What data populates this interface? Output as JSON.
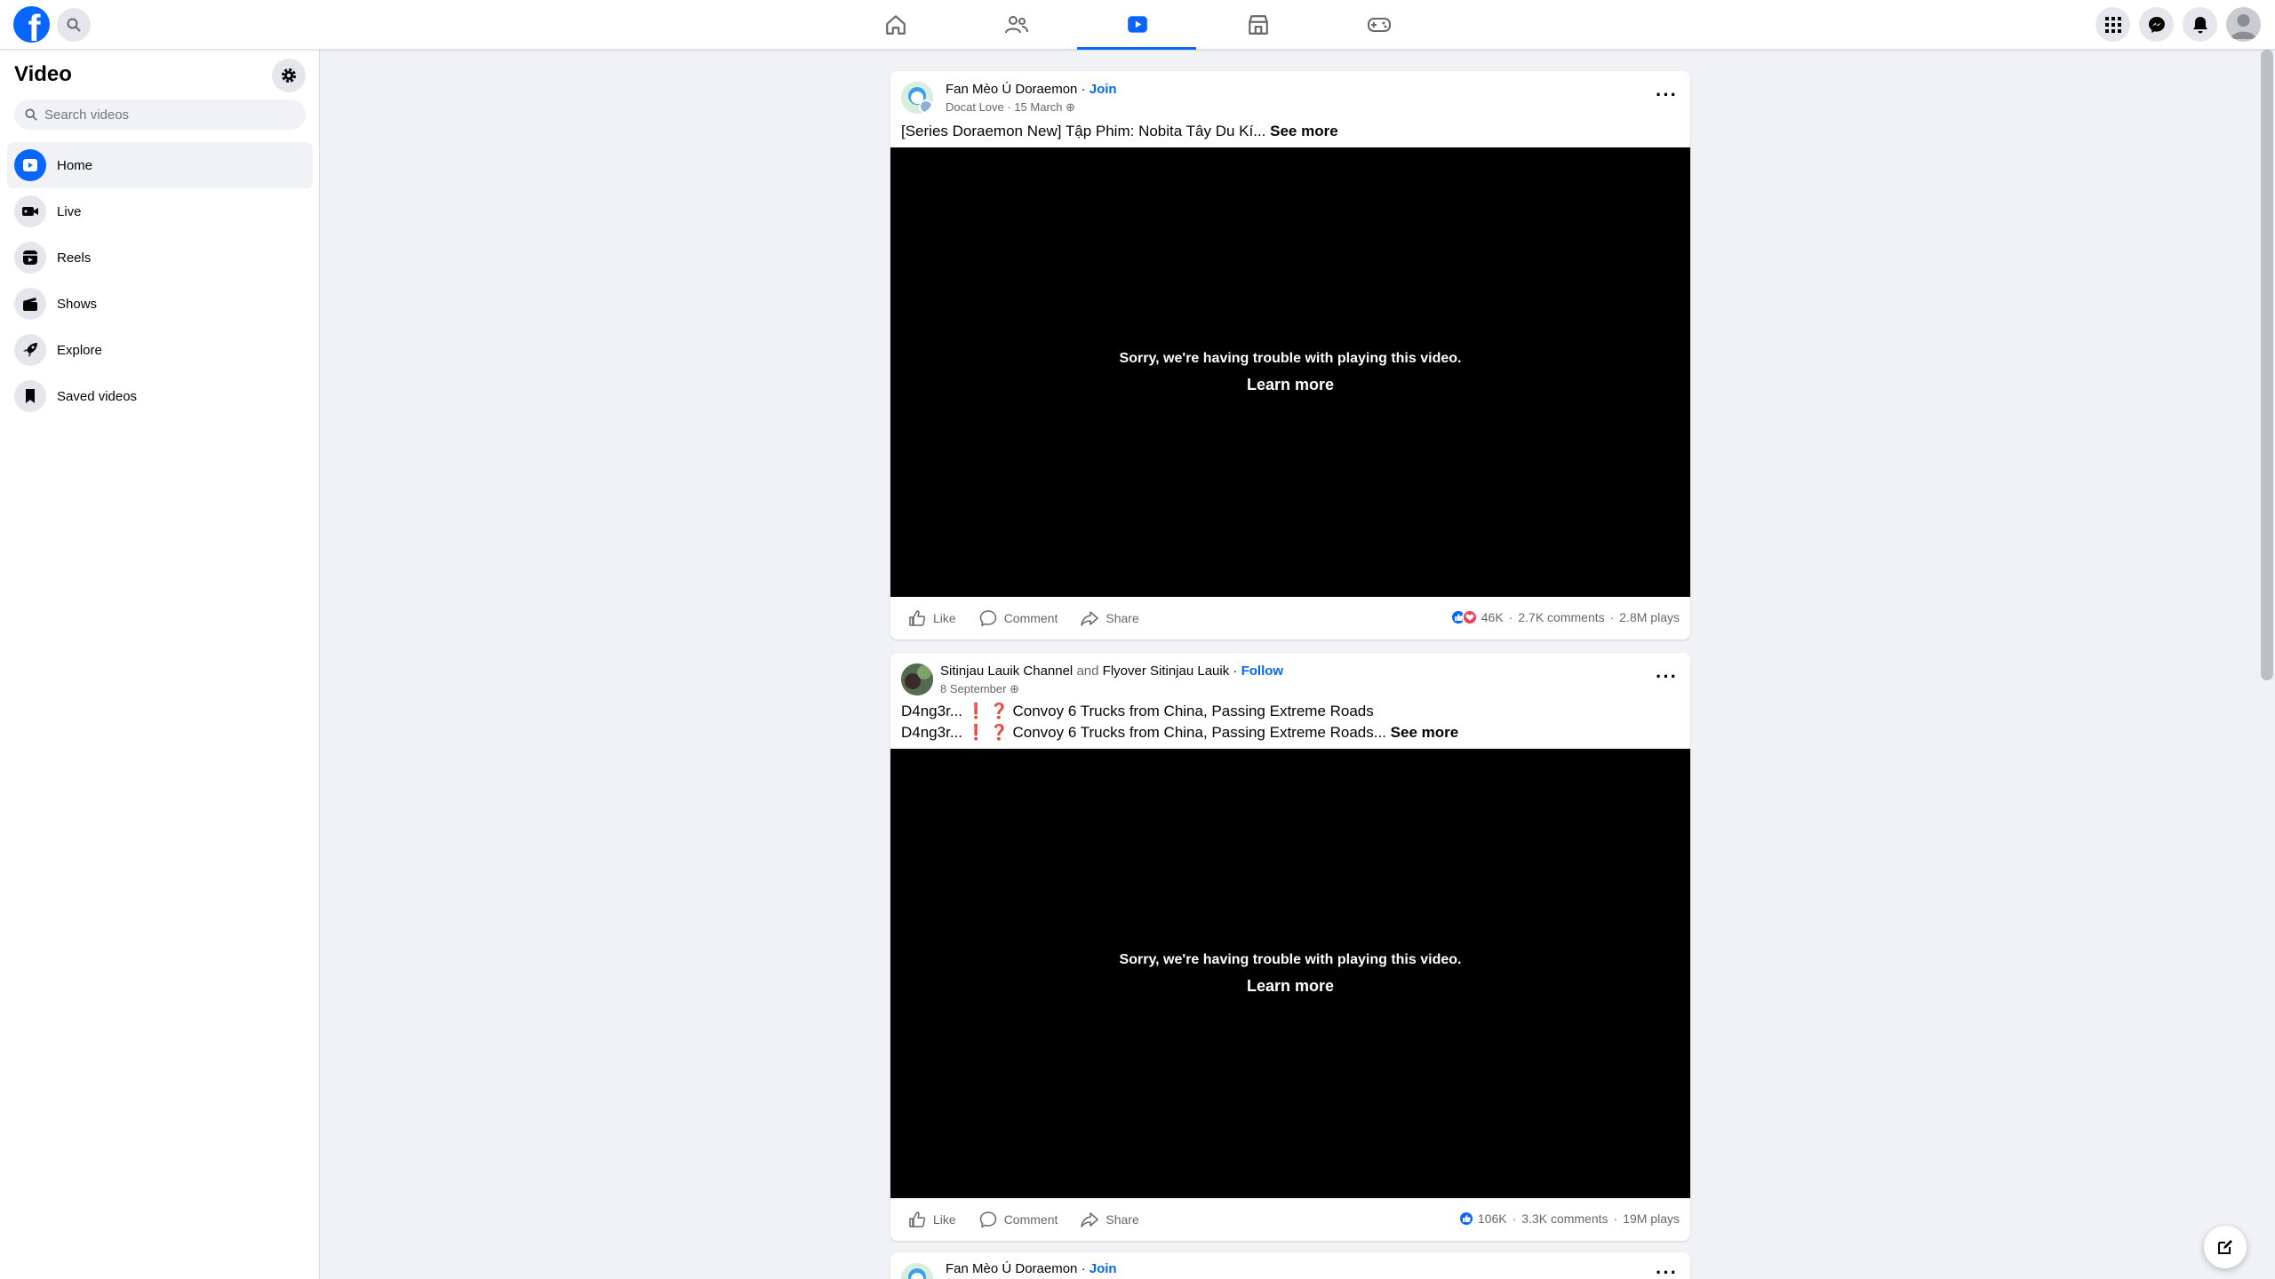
{
  "header": {
    "nav_tabs": [
      {
        "name": "home",
        "active": false
      },
      {
        "name": "friends",
        "active": false
      },
      {
        "name": "video",
        "active": true
      },
      {
        "name": "marketplace",
        "active": false
      },
      {
        "name": "gaming",
        "active": false
      }
    ],
    "accent_color": "#0866ff"
  },
  "sidebar": {
    "title": "Video",
    "search_placeholder": "Search videos",
    "items": [
      {
        "label": "Home",
        "icon": "play-icon",
        "active": true
      },
      {
        "label": "Live",
        "icon": "live-camera-icon",
        "active": false
      },
      {
        "label": "Reels",
        "icon": "reels-icon",
        "active": false
      },
      {
        "label": "Shows",
        "icon": "clapper-icon",
        "active": false
      },
      {
        "label": "Explore",
        "icon": "rocket-icon",
        "active": false
      },
      {
        "label": "Saved videos",
        "icon": "bookmark-icon",
        "active": false
      }
    ]
  },
  "posts": [
    {
      "author": "Fan Mèo Ú Doraemon",
      "action": "Join",
      "sub_author": "Docat Love",
      "date": "15 March",
      "caption": "[Series Doraemon New] Tập Phim: Nobita Tây Du Kí...",
      "see_more": "See more",
      "video_error": "Sorry, we're having trouble with playing this video.",
      "learn_more": "Learn more",
      "like": "Like",
      "comment": "Comment",
      "share": "Share",
      "reactions": "46K",
      "comments": "2.7K comments",
      "plays": "2.8M plays"
    },
    {
      "author": "Sitinjau Lauik Channel",
      "and": "and",
      "co_author": "Flyover Sitinjau Lauik",
      "action": "Follow",
      "date": "8 September",
      "title": "D4ng3r... ❗ ❓ Convoy 6 Trucks from China, Passing Extreme Roads",
      "caption": "D4ng3r... ❗ ❓ Convoy 6 Trucks from China, Passing Extreme Roads...",
      "see_more": "See more",
      "video_error": "Sorry, we're having trouble with playing this video.",
      "learn_more": "Learn more",
      "like": "Like",
      "comment": "Comment",
      "share": "Share",
      "reactions": "106K",
      "comments": "3.3K comments",
      "plays": "19M plays"
    },
    {
      "author": "Fan Mèo Ú Doraemon",
      "action": "Join"
    }
  ]
}
